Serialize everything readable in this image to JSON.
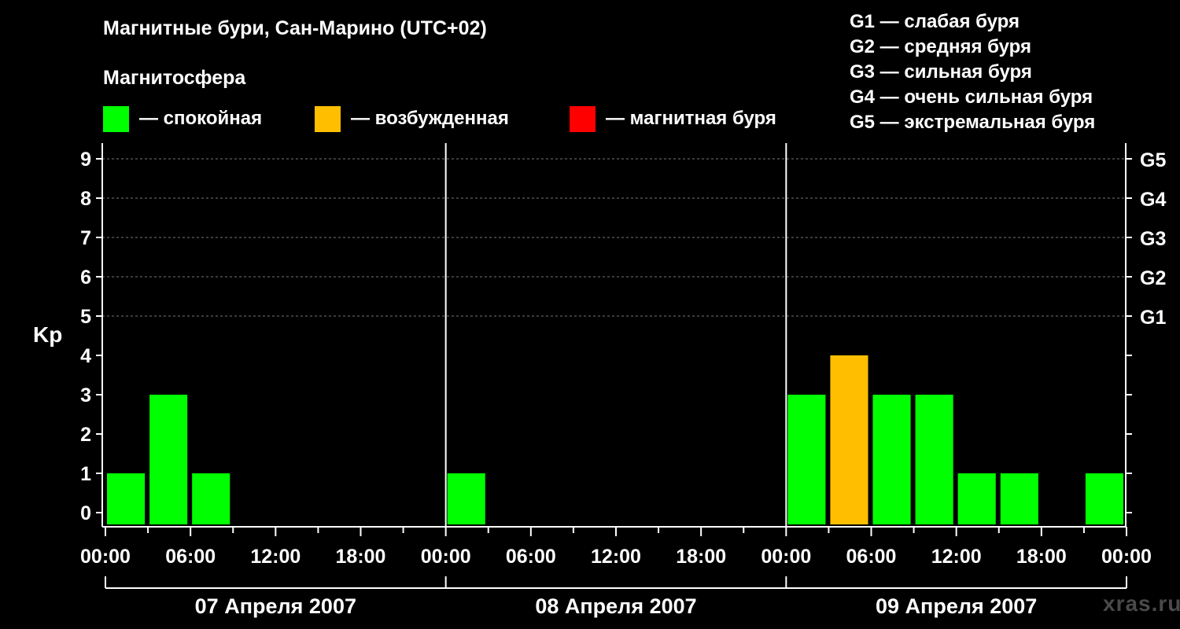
{
  "chart_data": {
    "type": "bar",
    "title": "Магнитные бури, Сан-Марино (UTC+02)",
    "subtitle": "Магнитосфера",
    "ylabel": "Kp",
    "ylim": [
      0,
      9
    ],
    "yticks": [
      "0",
      "1",
      "2",
      "3",
      "4",
      "5",
      "6",
      "7",
      "8",
      "9"
    ],
    "gscale": [
      {
        "kp": 5,
        "label": "G1"
      },
      {
        "kp": 6,
        "label": "G2"
      },
      {
        "kp": 7,
        "label": "G3"
      },
      {
        "kp": 8,
        "label": "G4"
      },
      {
        "kp": 9,
        "label": "G5"
      }
    ],
    "xticks": [
      "00:00",
      "06:00",
      "12:00",
      "18:00",
      "00:00",
      "06:00",
      "12:00",
      "18:00",
      "00:00",
      "06:00",
      "12:00",
      "18:00",
      "00:00"
    ],
    "days": [
      "07 Апреля 2007",
      "08 Апреля 2007",
      "09 Апреля 2007"
    ],
    "bars": [
      {
        "day": 0,
        "hour": 0,
        "kp": 1,
        "state": "quiet"
      },
      {
        "day": 0,
        "hour": 3,
        "kp": 3,
        "state": "quiet"
      },
      {
        "day": 0,
        "hour": 6,
        "kp": 1,
        "state": "quiet"
      },
      {
        "day": 1,
        "hour": 0,
        "kp": 1,
        "state": "quiet"
      },
      {
        "day": 2,
        "hour": 0,
        "kp": 3,
        "state": "quiet"
      },
      {
        "day": 2,
        "hour": 3,
        "kp": 4,
        "state": "excited"
      },
      {
        "day": 2,
        "hour": 6,
        "kp": 3,
        "state": "quiet"
      },
      {
        "day": 2,
        "hour": 9,
        "kp": 3,
        "state": "quiet"
      },
      {
        "day": 2,
        "hour": 12,
        "kp": 1,
        "state": "quiet"
      },
      {
        "day": 2,
        "hour": 15,
        "kp": 1,
        "state": "quiet"
      },
      {
        "day": 2,
        "hour": 21,
        "kp": 1,
        "state": "quiet"
      }
    ],
    "grid": true
  },
  "legend": [
    {
      "key": "quiet",
      "label": "— спокойная",
      "color": "#00ff00"
    },
    {
      "key": "excited",
      "label": "— возбужденная",
      "color": "#ffbf00"
    },
    {
      "key": "storm",
      "label": "— магнитная буря",
      "color": "#ff0000"
    }
  ],
  "gscale_legend": [
    "G1 — слабая буря",
    "G2 — средняя буря",
    "G3 — сильная буря",
    "G4 — очень сильная буря",
    "G5 — экстремальная буря"
  ],
  "watermark": "xras.ru"
}
